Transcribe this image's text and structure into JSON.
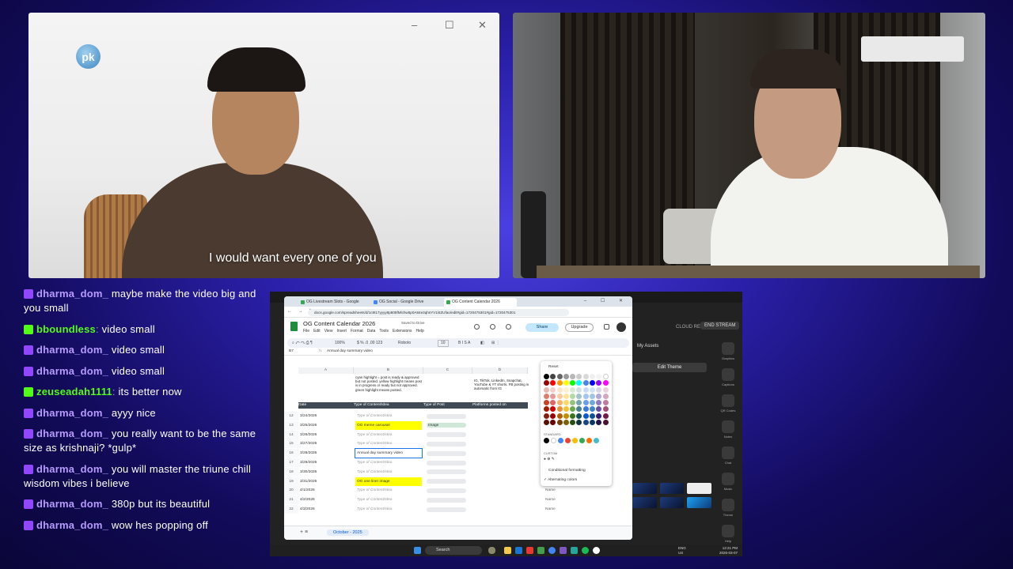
{
  "video_left": {
    "caption": "I would want every one of you",
    "logo_text": "pk",
    "window_controls": [
      "–",
      "☐",
      "✕"
    ]
  },
  "chat": {
    "messages": [
      {
        "badge": "twitch",
        "user": "dharma_dom_",
        "text": "maybe make the video big and you small"
      },
      {
        "badge": "kick",
        "user": "bboundless",
        "text": "video small"
      },
      {
        "badge": "twitch",
        "user": "dharma_dom_",
        "text": "video small"
      },
      {
        "badge": "twitch",
        "user": "dharma_dom_",
        "text": "video small"
      },
      {
        "badge": "kick",
        "user": "zeuseadah1111",
        "text": "its better now"
      },
      {
        "badge": "twitch",
        "user": "dharma_dom_",
        "text": "ayyy nice"
      },
      {
        "badge": "twitch",
        "user": "dharma_dom_",
        "text": "you really want to be the same size as krishnaji? *gulp*"
      },
      {
        "badge": "twitch",
        "user": "dharma_dom_",
        "text": "you will master the triune chill wisdom vibes i believe"
      },
      {
        "badge": "twitch",
        "user": "dharma_dom_",
        "text": "380p but its beautiful"
      },
      {
        "badge": "twitch",
        "user": "dharma_dom_",
        "text": "wow hes popping off"
      }
    ]
  },
  "stream_app": {
    "end_stream": "END STREAM",
    "cloud_rec": "CLOUD REC",
    "my_assets": "My Assets",
    "edit_theme": "Edit Theme",
    "side_labels": [
      "Graphics",
      "Captions",
      "QR Codes",
      "Notes",
      "Chat",
      "Music",
      "Theme",
      "Help"
    ]
  },
  "chrome": {
    "tabs": [
      {
        "label": "OG Livestream Slots - Google",
        "color": "#34a853"
      },
      {
        "label": "OG Social - Google Drive",
        "color": "#4285f4"
      },
      {
        "label": "OG Content Calendar 2026",
        "color": "#34a853",
        "active": true
      }
    ],
    "url": "docs.google.com/spreadsheets/d/1c9t17yyyy8p808fMlchw5p0A84e3qhsYV1l4ZUfao/edit#gid=1720475301#gid=1720475301"
  },
  "sheet": {
    "title": "OG Content Calendar 2026",
    "saved_status": "Saved to Drive",
    "menus": [
      "File",
      "Edit",
      "View",
      "Insert",
      "Format",
      "Data",
      "Tools",
      "Extensions",
      "Help"
    ],
    "share_label": "Share",
    "upgrade_label": "Upgrade",
    "toolbar": {
      "zoom": "100%",
      "font": "Roboto",
      "font_size": "10"
    },
    "cell_ref": "B7",
    "formula_text": "Annual day summary video",
    "col_headers": [
      "A",
      "B",
      "C",
      "D"
    ],
    "note_b1": "cyan highlight = post is ready & approved but not posted. yellow highlight means post is in progress or ready but not approved. green highlight means posted.",
    "note_d1": "IG, TikTok, LinkedIn, Snapchat, YouTube & YT shorts. FB posting is automatic from IG",
    "header_row": {
      "date": "Date",
      "type_content": "Type of Content/Idea",
      "type_post": "Type of Post",
      "platforms": "Platforms posted on"
    },
    "rows": [
      {
        "num": "12",
        "date": "3/24/2026",
        "content": "Type of Content/Idea",
        "placeholder": true,
        "post": "",
        "highlight": false
      },
      {
        "num": "13",
        "date": "3/25/2026",
        "content": "OG meme carousel",
        "placeholder": false,
        "post": "Image",
        "highlight": true
      },
      {
        "num": "14",
        "date": "3/26/2026",
        "content": "Type of Content/Idea",
        "placeholder": true,
        "post": "",
        "highlight": false
      },
      {
        "num": "15",
        "date": "3/27/2026",
        "content": "Type of Content/Idea",
        "placeholder": true,
        "post": "",
        "highlight": false
      },
      {
        "num": "16",
        "date": "3/28/2026",
        "content": "Annual day summary video",
        "placeholder": false,
        "post": "",
        "highlight": false,
        "selected": true
      },
      {
        "num": "17",
        "date": "3/29/2026",
        "content": "Type of Content/Idea",
        "placeholder": true,
        "post": "",
        "highlight": false
      },
      {
        "num": "18",
        "date": "3/30/2026",
        "content": "Type of Content/Idea",
        "placeholder": true,
        "post": "",
        "highlight": false
      },
      {
        "num": "19",
        "date": "3/31/2026",
        "content": "OG one liner image",
        "placeholder": false,
        "post": "",
        "highlight": true
      },
      {
        "num": "20",
        "date": "4/1/2026",
        "content": "Type of Content/Idea",
        "placeholder": true,
        "post": "",
        "highlight": false
      },
      {
        "num": "21",
        "date": "4/2/2026",
        "content": "Type of Content/Idea",
        "placeholder": true,
        "post": "",
        "highlight": false
      },
      {
        "num": "22",
        "date": "4/3/2026",
        "content": "Type of Content/Idea",
        "placeholder": true,
        "post": "",
        "highlight": false
      }
    ],
    "name_chips": [
      "Name",
      "Name",
      "Name"
    ],
    "sheet_tab": "October - 2025"
  },
  "color_popup": {
    "reset": "Reset",
    "standard": "STANDARD",
    "custom": "CUSTOM",
    "conditional": "Conditional formatting",
    "alternating": "Alternating colors"
  },
  "taskbar": {
    "search": "Search",
    "lang": "ENG",
    "region": "US",
    "time": "12:21 PM",
    "date": "2026-03-07"
  }
}
